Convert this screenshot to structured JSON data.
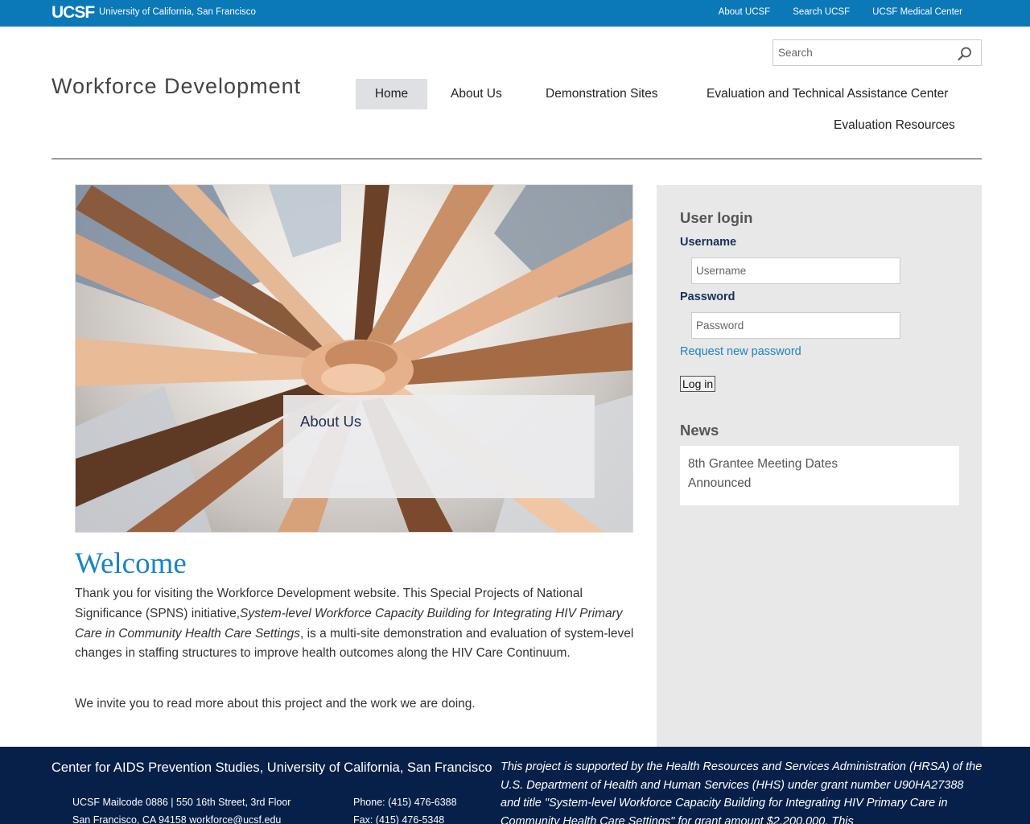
{
  "topbar": {
    "logo": "UCSF",
    "university": "University of California, San Francisco",
    "links": [
      "About UCSF",
      "Search UCSF",
      "UCSF Medical Center"
    ]
  },
  "search": {
    "placeholder": "Search",
    "icon": "search-icon"
  },
  "site_title": "Workforce Development",
  "nav": [
    "Home",
    "About Us",
    "Demonstration Sites",
    "Evaluation and Technical Assistance Center",
    "Evaluation Resources"
  ],
  "nav_active": "Home",
  "hero": {
    "caption": "About Us"
  },
  "main": {
    "heading": "Welcome",
    "intro_before": "Thank you for visiting the Workforce Development website. This Special Projects of National Significance (SPNS) initiative,",
    "intro_italic": "System-level Workforce Capacity Building for Integrating HIV Primary Care in Community Health Care Settings",
    "intro_after": ", is a multi-site demonstration and evaluation of system-level changes in staffing structures to improve health outcomes along the HIV Care Continuum.",
    "invite": "We invite you to read more about this project and the work we are doing."
  },
  "login": {
    "heading": "User login",
    "username_label": "Username",
    "username_placeholder": "Username",
    "password_label": "Password",
    "password_placeholder": "Password",
    "request_link": "Request new password",
    "button": "Log in"
  },
  "news": {
    "heading": "News",
    "item": "8th Grantee Meeting Dates Announced"
  },
  "footer": {
    "org": "Center for AIDS Prevention Studies, University of California, San Francisco",
    "address_line1": "UCSF Mailcode 0886 | 550 16th Street, 3rd Floor",
    "address_line2": "San Francisco, CA 94158 workforce@ucsf.edu",
    "phone": "Phone: (415) 476-6388",
    "fax": "Fax: (415) 476-5348",
    "support": "This project is supported by the Health Resources and Services Administration (HRSA) of the U.S. Department of Health and Human Services (HHS) under grant number U90HA27388 and title \"System-level Workforce Capacity Building for Integrating HIV Primary Care in Community Health Care Settings\" for grant amount $2,200,000. This"
  },
  "colors": {
    "topbar": "#0b78b8",
    "footer": "#062049",
    "link": "#1a84c4",
    "label": "#18305a",
    "sidebar": "#e8e8e8"
  }
}
